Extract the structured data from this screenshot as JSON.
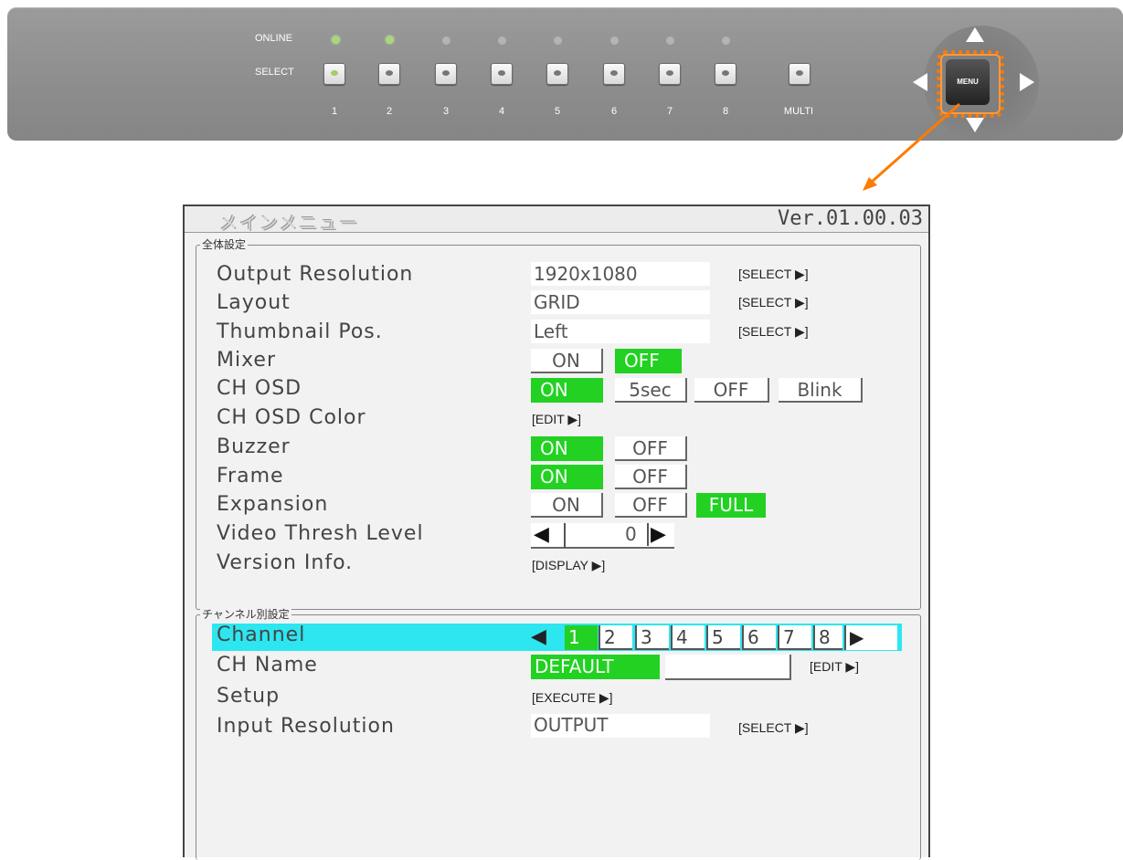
{
  "panel": {
    "online_label": "ONLINE",
    "select_label": "SELECT",
    "channels": [
      "1",
      "2",
      "3",
      "4",
      "5",
      "6",
      "7",
      "8"
    ],
    "online_leds": [
      true,
      true,
      false,
      false,
      false,
      false,
      false,
      false
    ],
    "multi_label": "MULTI",
    "menu_label": "MENU",
    "highlight_color": "#ff7a00"
  },
  "osd": {
    "title": "メインメニュー",
    "version": "Ver.01.00.03",
    "general": {
      "section_title": "全体設定",
      "rows": [
        {
          "label": "Output Resolution",
          "value": "1920x1080",
          "action": "[SELECT ▶]"
        },
        {
          "label": "Layout",
          "value": "GRID",
          "action": "[SELECT ▶]"
        },
        {
          "label": "Thumbnail Pos.",
          "value": "Left",
          "action": "[SELECT ▶]"
        },
        {
          "label": "Mixer",
          "options": [
            "ON",
            "OFF"
          ],
          "selected": "OFF"
        },
        {
          "label": "CH OSD",
          "options": [
            "ON",
            "5sec",
            "OFF",
            "Blink"
          ],
          "selected": "ON"
        },
        {
          "label": "CH OSD Color",
          "action": "[EDIT ▶]"
        },
        {
          "label": "Buzzer",
          "options": [
            "ON",
            "OFF"
          ],
          "selected": "ON"
        },
        {
          "label": "Frame",
          "options": [
            "ON",
            "OFF"
          ],
          "selected": "ON"
        },
        {
          "label": "Expansion",
          "options": [
            "ON",
            "OFF",
            "FULL"
          ],
          "selected": "FULL"
        },
        {
          "label": "Video Thresh Level",
          "value": "0"
        },
        {
          "label": "Version Info.",
          "action": "[DISPLAY ▶]"
        }
      ]
    },
    "channel": {
      "section_title": "チャンネル別設定",
      "channel_label": "Channel",
      "channels": [
        "1",
        "2",
        "3",
        "4",
        "5",
        "6",
        "7",
        "8"
      ],
      "selected_channel": "1",
      "ch_name_label": "CH Name",
      "ch_name_value": "DEFAULT",
      "ch_name_action": "[EDIT ▶]",
      "setup_label": "Setup",
      "setup_action": "[EXECUTE ▶]",
      "input_res_label": "Input Resolution",
      "input_res_value": "OUTPUT",
      "input_res_action": "[SELECT ▶]"
    },
    "colors": {
      "selected": "#22d122",
      "row_highlight": "#2de6f0"
    }
  }
}
